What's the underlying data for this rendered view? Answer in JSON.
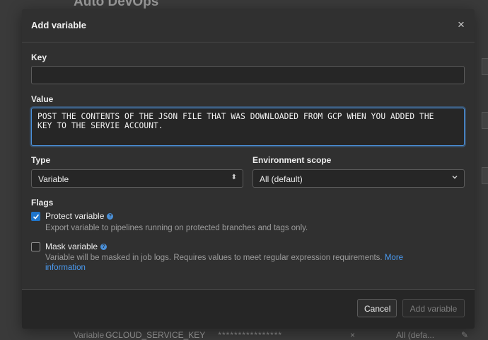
{
  "background": {
    "page_title": "Auto DevOps",
    "row": {
      "type": "Variable",
      "name": "GCLOUD_SERVICE_KEY",
      "masked_value": "****************",
      "scope": "All (defa..."
    }
  },
  "modal": {
    "title": "Add variable",
    "close_label": "×",
    "key": {
      "label": "Key",
      "value": ""
    },
    "value": {
      "label": "Value",
      "text": "POST THE CONTENTS OF THE JSON FILE THAT WAS DOWNLOADED FROM GCP WHEN YOU ADDED THE\nKEY TO THE SERVIE ACCOUNT."
    },
    "type": {
      "label": "Type",
      "selected": "Variable"
    },
    "environment_scope": {
      "label": "Environment scope",
      "selected": "All (default)"
    },
    "flags": {
      "label": "Flags",
      "protect": {
        "label": "Protect variable",
        "checked": true,
        "description": "Export variable to pipelines running on protected branches and tags only."
      },
      "mask": {
        "label": "Mask variable",
        "checked": false,
        "description": "Variable will be masked in job logs. Requires values to meet regular expression requirements.",
        "link_text_1": "More",
        "link_text_2": "information"
      }
    },
    "footer": {
      "cancel_label": "Cancel",
      "add_label": "Add variable"
    }
  },
  "colors": {
    "accent": "#1f75cb",
    "link": "#4a9af0",
    "modal_bg": "#303030"
  }
}
